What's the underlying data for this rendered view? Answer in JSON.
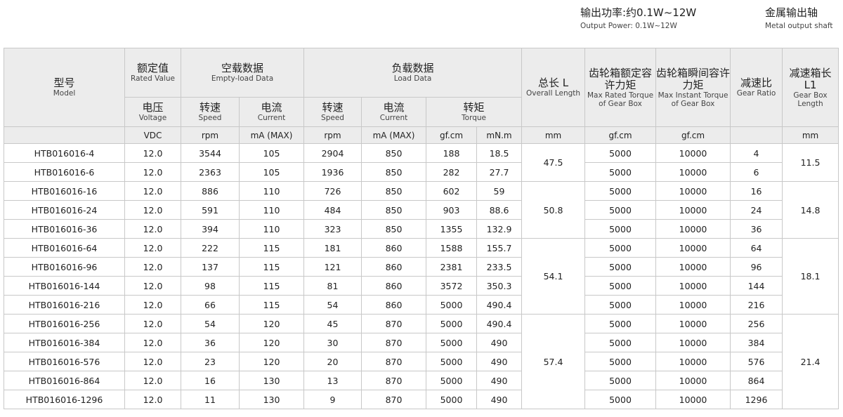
{
  "header_right": {
    "power_zh": "输出功率:约0.1W~12W",
    "power_en": "Output Power: 0.1W~12W",
    "shaft_zh": "金属输出轴",
    "shaft_en": "Metal output shaft"
  },
  "table": {
    "model": {
      "zh": "型号",
      "en": "Model"
    },
    "rated": {
      "zh": "额定值",
      "en": "Rated Value"
    },
    "noload": {
      "zh": "空载数据",
      "en": "Empty-load Data"
    },
    "load": {
      "zh": "负载数据",
      "en": "Load Data"
    },
    "length": {
      "zh": "总长 L",
      "en": "Overall Length"
    },
    "max_rated": {
      "zh": "齿轮箱额定容许力矩",
      "en": "Max Rated Torque of Gear Box"
    },
    "max_instant": {
      "zh": "齿轮箱瞬间容许力矩",
      "en": "Max Instant Torque of Gear Box"
    },
    "ratio": {
      "zh": "减速比",
      "en": "Gear Ratio"
    },
    "gb_length": {
      "zh": "减速箱长 L1",
      "en": "Gear Box Length"
    },
    "voltage": {
      "zh": "电压",
      "en": "Voltage"
    },
    "speed": {
      "zh": "转速",
      "en": "Speed"
    },
    "current": {
      "zh": "电流",
      "en": "Current"
    },
    "torque": {
      "zh": "转矩",
      "en": "Torque"
    },
    "units": {
      "voltage": "VDC",
      "nl_speed": "rpm",
      "nl_current": "mA (MAX)",
      "l_speed": "rpm",
      "l_current": "mA (MAX)",
      "torque_gf": "gf.cm",
      "torque_mn": "mN.m",
      "length": "mm",
      "max_rated": "gf.cm",
      "max_instant": "gf.cm",
      "ratio": "",
      "gb_length": "mm"
    },
    "rows": [
      {
        "model": "HTB016016-4",
        "v": "12.0",
        "nls": "3544",
        "nlc": "105",
        "ls": "2904",
        "lc": "850",
        "tg": "188",
        "tm": "18.5",
        "mr": "5000",
        "mi": "10000",
        "r": "4"
      },
      {
        "model": "HTB016016-6",
        "v": "12.0",
        "nls": "2363",
        "nlc": "105",
        "ls": "1936",
        "lc": "850",
        "tg": "282",
        "tm": "27.7",
        "mr": "5000",
        "mi": "10000",
        "r": "6"
      },
      {
        "model": "HTB016016-16",
        "v": "12.0",
        "nls": "886",
        "nlc": "110",
        "ls": "726",
        "lc": "850",
        "tg": "602",
        "tm": "59",
        "mr": "5000",
        "mi": "10000",
        "r": "16"
      },
      {
        "model": "HTB016016-24",
        "v": "12.0",
        "nls": "591",
        "nlc": "110",
        "ls": "484",
        "lc": "850",
        "tg": "903",
        "tm": "88.6",
        "mr": "5000",
        "mi": "10000",
        "r": "24"
      },
      {
        "model": "HTB016016-36",
        "v": "12.0",
        "nls": "394",
        "nlc": "110",
        "ls": "323",
        "lc": "850",
        "tg": "1355",
        "tm": "132.9",
        "mr": "5000",
        "mi": "10000",
        "r": "36"
      },
      {
        "model": "HTB016016-64",
        "v": "12.0",
        "nls": "222",
        "nlc": "115",
        "ls": "181",
        "lc": "860",
        "tg": "1588",
        "tm": "155.7",
        "mr": "5000",
        "mi": "10000",
        "r": "64"
      },
      {
        "model": "HTB016016-96",
        "v": "12.0",
        "nls": "137",
        "nlc": "115",
        "ls": "121",
        "lc": "860",
        "tg": "2381",
        "tm": "233.5",
        "mr": "5000",
        "mi": "10000",
        "r": "96"
      },
      {
        "model": "HTB016016-144",
        "v": "12.0",
        "nls": "98",
        "nlc": "115",
        "ls": "81",
        "lc": "860",
        "tg": "3572",
        "tm": "350.3",
        "mr": "5000",
        "mi": "10000",
        "r": "144"
      },
      {
        "model": "HTB016016-216",
        "v": "12.0",
        "nls": "66",
        "nlc": "115",
        "ls": "54",
        "lc": "860",
        "tg": "5000",
        "tm": "490.4",
        "mr": "5000",
        "mi": "10000",
        "r": "216"
      },
      {
        "model": "HTB016016-256",
        "v": "12.0",
        "nls": "54",
        "nlc": "120",
        "ls": "45",
        "lc": "870",
        "tg": "5000",
        "tm": "490.4",
        "mr": "5000",
        "mi": "10000",
        "r": "256"
      },
      {
        "model": "HTB016016-384",
        "v": "12.0",
        "nls": "36",
        "nlc": "120",
        "ls": "30",
        "lc": "870",
        "tg": "5000",
        "tm": "490",
        "mr": "5000",
        "mi": "10000",
        "r": "384"
      },
      {
        "model": "HTB016016-576",
        "v": "12.0",
        "nls": "23",
        "nlc": "120",
        "ls": "20",
        "lc": "870",
        "tg": "5000",
        "tm": "490",
        "mr": "5000",
        "mi": "10000",
        "r": "576"
      },
      {
        "model": "HTB016016-864",
        "v": "12.0",
        "nls": "16",
        "nlc": "130",
        "ls": "13",
        "lc": "870",
        "tg": "5000",
        "tm": "490",
        "mr": "5000",
        "mi": "10000",
        "r": "864"
      },
      {
        "model": "HTB016016-1296",
        "v": "12.0",
        "nls": "11",
        "nlc": "130",
        "ls": "9",
        "lc": "870",
        "tg": "5000",
        "tm": "490",
        "mr": "5000",
        "mi": "10000",
        "r": "1296"
      }
    ],
    "length_groups": [
      {
        "value": "47.5",
        "span": 2
      },
      {
        "value": "50.8",
        "span": 3
      },
      {
        "value": "54.1",
        "span": 4
      },
      {
        "value": "57.4",
        "span": 5
      }
    ],
    "gb_groups": [
      {
        "value": "11.5",
        "span": 2
      },
      {
        "value": "14.8",
        "span": 3
      },
      {
        "value": "18.1",
        "span": 4
      },
      {
        "value": "21.4",
        "span": 5
      }
    ]
  }
}
